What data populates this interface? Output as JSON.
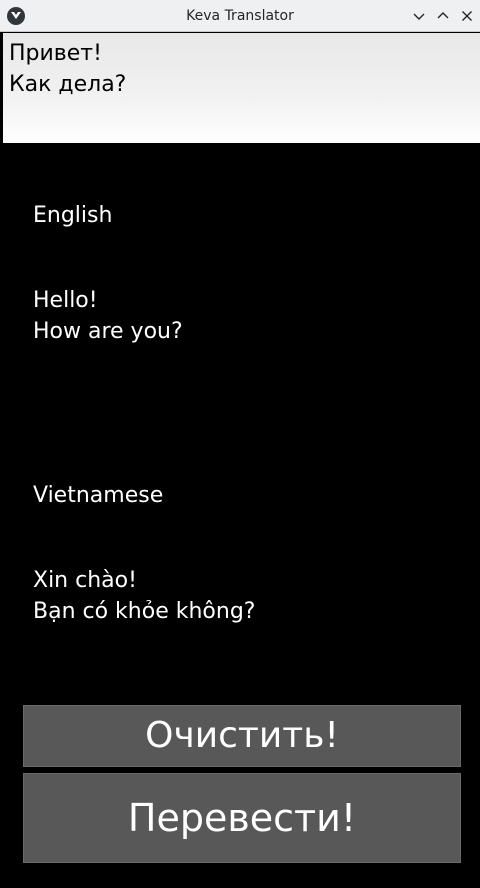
{
  "window": {
    "title": "Keva Translator",
    "app_icon": "kivy-logo-icon",
    "controls": [
      "minimize-icon",
      "maximize-icon",
      "close-icon"
    ]
  },
  "input": {
    "text": "Привет!\nКак дела?"
  },
  "source": {
    "language": "English",
    "translation": "Hello!\nHow are you?"
  },
  "target": {
    "language": "Vietnamese",
    "translation": "Xin chào!\nBạn có khỏe không?"
  },
  "buttons": {
    "clear_label": "Очистить!",
    "translate_label": "Перевести!"
  },
  "colors": {
    "background": "#000000",
    "button": "#585858",
    "titlebar": "#eff0f1"
  }
}
